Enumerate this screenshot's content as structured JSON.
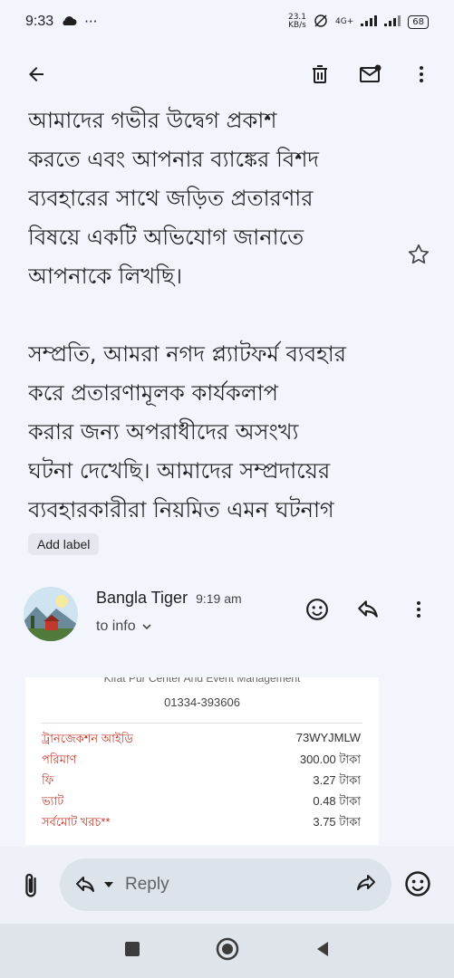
{
  "status_bar": {
    "time": "9:33",
    "more_indicator": "···",
    "net_speed_value": "23.1",
    "net_speed_unit": "KB/s",
    "network_type": "4G+",
    "battery": "68"
  },
  "app_bar": {
    "icons": [
      "back-arrow-icon",
      "trash-icon",
      "mark-unread-icon",
      "more-vert-icon"
    ]
  },
  "email_body": {
    "paragraph1_lines": [
      "আমাদের গভীর উদ্বেগ প্রকাশ",
      "করতে এবং আপনার ব্যাঙ্কের বিশদ",
      "ব্যবহারের সাথে জড়িত প্রতারণার",
      "বিষয়ে একটি অভিযোগ জানাতে",
      "আপনাকে লিখছি।"
    ],
    "paragraph2_lines": [
      "সম্প্রতি, আমরা নগদ প্ল্যাটফর্ম ব্যবহার",
      "করে প্রতারণামূলক কার্যকলাপ",
      "করার জন্য অপরাধীদের অসংখ্য",
      "ঘটনা দেখেছি। আমাদের সম্প্রদায়ের",
      "ব্যবহারকারীরা নিয়মিত এমন ঘটনাগ"
    ]
  },
  "add_label_chip": "Add label",
  "message": {
    "sender_name": "Bangla Tiger",
    "time": "9:19 am",
    "recipient": "to info"
  },
  "receipt": {
    "company": "Kifat Pur Center And Event Management",
    "phone": "01334-393606",
    "rows": [
      {
        "label": "ট্রানজেকশন আইডি",
        "value": "73WYJMLW"
      },
      {
        "label": "পরিমাণ",
        "value": "300.00 টাকা"
      },
      {
        "label": "ফি",
        "value": "3.27 টাকা"
      },
      {
        "label": "ভ্যাট",
        "value": "0.48 টাকা"
      },
      {
        "label": "সর্বমোট খরচ**",
        "value": "3.75 টাকা"
      }
    ]
  },
  "composer": {
    "reply_placeholder": "Reply"
  },
  "colors": {
    "background": "#f2f6fc",
    "reply_pill": "#dde3ea",
    "receipt_label": "#c0392b",
    "nav_bar": "#dfe4ea"
  }
}
